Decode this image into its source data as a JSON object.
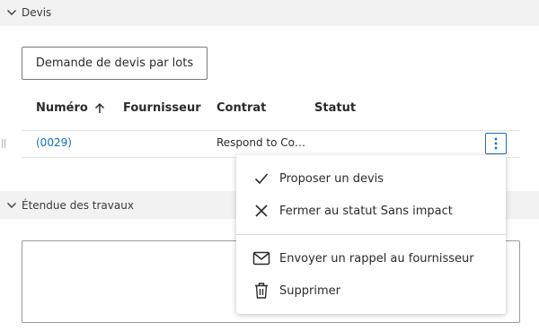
{
  "sections": {
    "devis": {
      "title": "Devis"
    },
    "etendue": {
      "title": "Étendue des travaux"
    }
  },
  "actions": {
    "batch_quote_label": "Demande de devis par lots"
  },
  "table": {
    "columns": [
      {
        "label": "Numéro",
        "sorted": "ascending"
      },
      {
        "label": "Fournisseur"
      },
      {
        "label": "Contrat"
      },
      {
        "label": "Statut"
      }
    ],
    "rows": [
      {
        "numero": "(0029)",
        "fournisseur": "",
        "contrat": "Respond to Co…",
        "statut": ""
      }
    ]
  },
  "context_menu": {
    "items": [
      {
        "label": "Proposer un devis",
        "icon": "check-icon"
      },
      {
        "label": "Fermer au statut Sans impact",
        "icon": "close-icon"
      },
      {
        "label": "Envoyer un rappel au fournisseur",
        "icon": "mail-icon"
      },
      {
        "label": "Supprimer",
        "icon": "trash-icon"
      }
    ]
  },
  "colors": {
    "link": "#0d6fb8",
    "accent_border": "#1b6ec2",
    "section_bg": "#f2f2f2"
  }
}
